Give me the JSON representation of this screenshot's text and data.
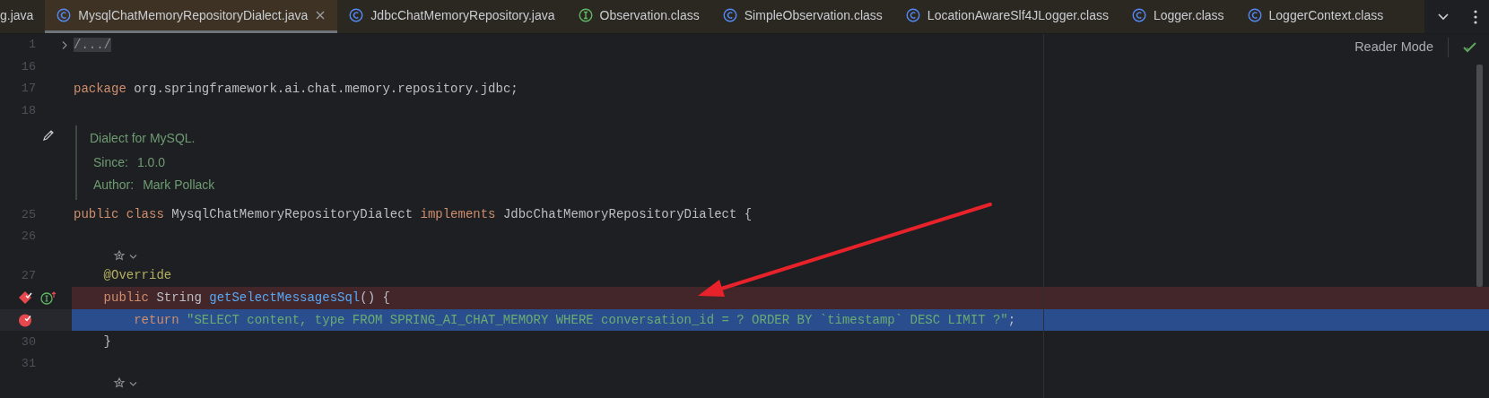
{
  "tabs": [
    {
      "label": "g.java",
      "selected": false
    },
    {
      "label": "MysqlChatMemoryRepositoryDialect.java",
      "kind": "class",
      "selected": true
    },
    {
      "label": "JdbcChatMemoryRepository.java",
      "kind": "class",
      "selected": false
    },
    {
      "label": "Observation.class",
      "kind": "interface",
      "selected": false
    },
    {
      "label": "SimpleObservation.class",
      "kind": "class",
      "selected": false
    },
    {
      "label": "LocationAwareSlf4JLogger.class",
      "kind": "class",
      "selected": false
    },
    {
      "label": "Logger.class",
      "kind": "class",
      "selected": false
    },
    {
      "label": "LoggerContext.class",
      "kind": "class",
      "selected": false
    }
  ],
  "reader_mode": {
    "label": "Reader Mode"
  },
  "lines": [
    {
      "kind": "code",
      "number": "1",
      "folded": true,
      "breakpoint": false,
      "execution_point": false,
      "implements": false,
      "tokens": [
        {
          "kind": "fold",
          "text": "/.../"
        }
      ]
    },
    {
      "kind": "code",
      "number": "16",
      "breakpoint": false,
      "execution_point": false,
      "implements": false
    },
    {
      "kind": "code",
      "number": "17",
      "breakpoint": false,
      "execution_point": false,
      "implements": false,
      "tokens": [
        {
          "kind": "keyword",
          "text": "package"
        },
        {
          "kind": "plain",
          "text": " org.springframework.ai.chat.memory.repository.jdbc;"
        }
      ]
    },
    {
      "kind": "code",
      "number": "18",
      "breakpoint": false,
      "execution_point": false,
      "implements": false
    },
    {
      "kind": "doc",
      "text": "Dialect for MySQL.",
      "tags": [
        {
          "label": "Since:",
          "value": "1.0.0"
        },
        {
          "label": "Author:",
          "value": "Mark Pollack"
        }
      ]
    },
    {
      "kind": "code",
      "number": "25",
      "breakpoint": false,
      "execution_point": false,
      "implements": false,
      "tokens": [
        {
          "kind": "keyword",
          "text": "public class"
        },
        {
          "kind": "plain",
          "text": " MysqlChatMemoryRepositoryDialect "
        },
        {
          "kind": "keyword",
          "text": "implements"
        },
        {
          "kind": "plain",
          "text": " JdbcChatMemoryRepositoryDialect {"
        }
      ],
      "children": [
        {
          "kind": "code",
          "number": "26",
          "breakpoint": false,
          "execution_point": false,
          "implements": false
        },
        {
          "kind": "hint"
        },
        {
          "kind": "code",
          "number": "27",
          "breakpoint": false,
          "execution_point": false,
          "implements": false,
          "tokens": [
            {
              "kind": "annotation",
              "text": "@Override"
            }
          ]
        },
        {
          "kind": "code",
          "breakpoint": true,
          "execution_point": false,
          "implements": true,
          "tokens": [
            {
              "kind": "keyword",
              "text": "public"
            },
            {
              "kind": "plain",
              "text": " String "
            },
            {
              "kind": "function",
              "text": "getSelectMessagesSql"
            },
            {
              "kind": "plain",
              "text": "() {"
            }
          ],
          "children": [
            {
              "kind": "code",
              "breakpoint": true,
              "execution_point": true,
              "implements": false,
              "tokens": [
                {
                  "kind": "keyword",
                  "text": "return"
                },
                {
                  "kind": "string",
                  "spaced": true,
                  "text": "\"SELECT content, type FROM SPRING_AI_CHAT_MEMORY WHERE conversation_id = ? ORDER BY `timestamp` DESC LIMIT ?\""
                },
                {
                  "kind": "plain",
                  "text": ";"
                }
              ]
            }
          ]
        },
        {
          "kind": "code",
          "number": "30",
          "breakpoint": false,
          "execution_point": false,
          "implements": false,
          "tokens": [
            {
              "kind": "plain",
              "text": "}"
            }
          ]
        },
        {
          "kind": "code",
          "number": "31",
          "breakpoint": false,
          "execution_point": false,
          "implements": false
        },
        {
          "kind": "hint"
        }
      ]
    }
  ]
}
